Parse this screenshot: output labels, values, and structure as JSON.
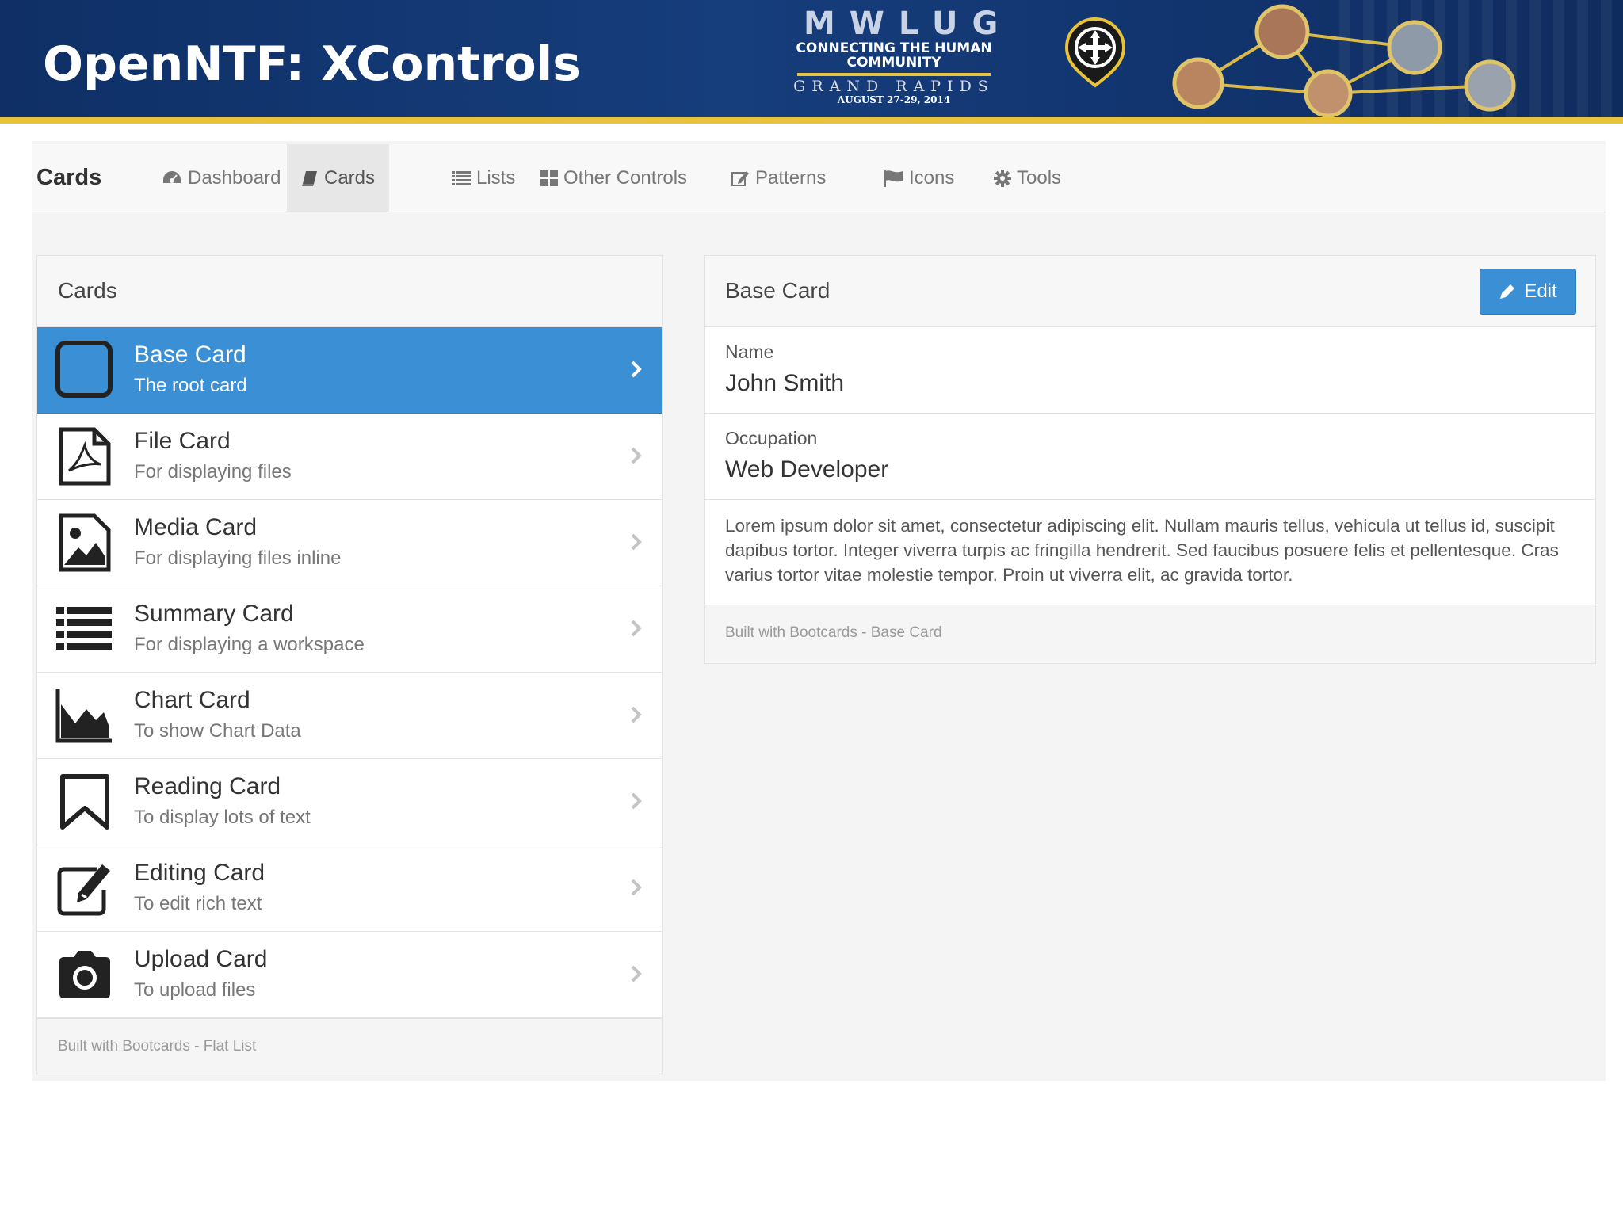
{
  "slide": {
    "title": "OpenNTF: XControls",
    "logo": {
      "acronym": "MWLUG",
      "tagline_1": "CONNECTING THE HUMAN",
      "tagline_2": "COMMUNITY",
      "city": "GRAND RAPIDS",
      "dates": "AUGUST 27-29, 2014"
    }
  },
  "nav": {
    "brand": "Cards",
    "items": [
      {
        "label": "Dashboard",
        "icon": "dashboard-icon"
      },
      {
        "label": "Cards",
        "icon": "book-icon",
        "active": true
      },
      {
        "label": "Lists",
        "icon": "list-icon"
      },
      {
        "label": "Other Controls",
        "icon": "grid-icon"
      },
      {
        "label": "Patterns",
        "icon": "edit-icon"
      },
      {
        "label": "Icons",
        "icon": "flag-icon"
      },
      {
        "label": "Tools",
        "icon": "gear-icon"
      }
    ]
  },
  "list_panel": {
    "title": "Cards",
    "items": [
      {
        "name": "Base Card",
        "desc": "The root card",
        "icon": "square-icon",
        "active": true
      },
      {
        "name": "File Card",
        "desc": "For displaying files",
        "icon": "pdf-file-icon"
      },
      {
        "name": "Media Card",
        "desc": "For displaying files inline",
        "icon": "image-icon"
      },
      {
        "name": "Summary Card",
        "desc": "For displaying a workspace",
        "icon": "list-icon"
      },
      {
        "name": "Chart Card",
        "desc": "To show Chart Data",
        "icon": "area-chart-icon"
      },
      {
        "name": "Reading Card",
        "desc": "To display lots of text",
        "icon": "bookmark-icon"
      },
      {
        "name": "Editing Card",
        "desc": "To edit rich text",
        "icon": "edit-icon"
      },
      {
        "name": "Upload Card",
        "desc": "To upload files",
        "icon": "camera-icon"
      }
    ],
    "footer": "Built with Bootcards - Flat List"
  },
  "detail_panel": {
    "title": "Base Card",
    "edit_label": "Edit",
    "fields": [
      {
        "label": "Name",
        "value": "John Smith"
      },
      {
        "label": "Occupation",
        "value": "Web Developer"
      }
    ],
    "body": "Lorem ipsum dolor sit amet, consectetur adipiscing elit. Nullam mauris tellus, vehicula ut tellus id, suscipit dapibus tortor. Integer viverra turpis ac fringilla hendrerit. Sed faucibus posuere felis et pellentesque. Cras varius tortor vitae molestie tempor. Proin ut viverra elit, ac gravida tortor.",
    "footer": "Built with Bootcards - Base Card"
  },
  "colors": {
    "banner": "#163e7c",
    "banner_accent": "#e8c33a",
    "primary": "#3b8fd5"
  }
}
